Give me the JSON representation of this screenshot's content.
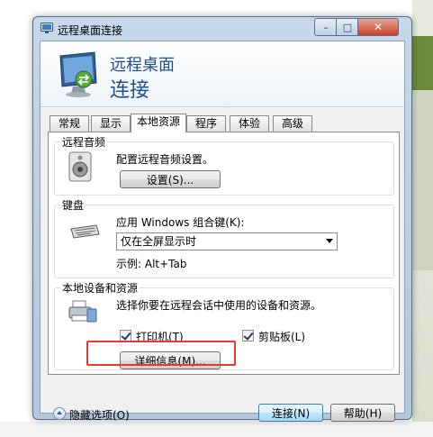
{
  "window": {
    "title": "远程桌面连接",
    "minimize_glyph": "–",
    "maximize_glyph": "□",
    "close_glyph": "✕"
  },
  "banner": {
    "line1": "远程桌面",
    "line2": "连接"
  },
  "tabs": [
    {
      "label": "常规"
    },
    {
      "label": "显示"
    },
    {
      "label": "本地资源"
    },
    {
      "label": "程序"
    },
    {
      "label": "体验"
    },
    {
      "label": "高级"
    }
  ],
  "active_tab": "本地资源",
  "audio": {
    "title": "远程音频",
    "description": "配置远程音频设置。",
    "settings_button": "设置(S)..."
  },
  "keyboard": {
    "title": "键盘",
    "label": "应用 Windows 组合键(K):",
    "selected": "仅在全屏显示时",
    "example": "示例: Alt+Tab"
  },
  "devices": {
    "title": "本地设备和资源",
    "description": "选择你要在远程会话中使用的设备和资源。",
    "printer_label": "打印机(T)",
    "printer_checked": true,
    "clipboard_label": "剪贴板(L)",
    "clipboard_checked": true,
    "details_button": "详细信息(M)..."
  },
  "footer": {
    "hide_options": "隐藏选项(O)",
    "connect_button": "连接(N)",
    "help_button": "帮助(H)"
  },
  "colors": {
    "banner_text": "#1f4e8f",
    "highlight_box": "#e53935"
  }
}
